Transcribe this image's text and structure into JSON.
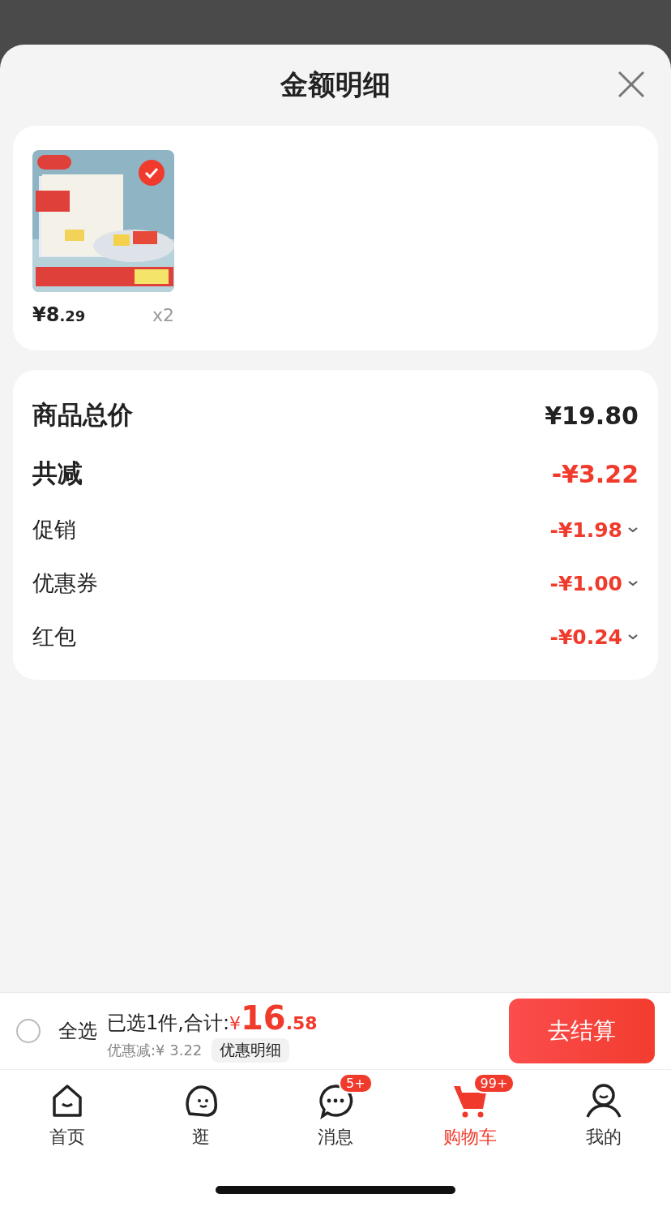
{
  "sheet": {
    "title": "金额明细"
  },
  "product": {
    "selected": true,
    "currency": "¥",
    "price_int": "8",
    "price_dec": ".29",
    "quantity": "x2"
  },
  "summary": [
    {
      "kind": "major",
      "label": "商品总价",
      "value": "¥19.80",
      "negative": false
    },
    {
      "kind": "major",
      "label": "共减",
      "value": "-¥3.22",
      "negative": true
    },
    {
      "kind": "minor",
      "label": "促销",
      "value": "-¥1.98",
      "negative": true,
      "expanded": false
    },
    {
      "kind": "minor",
      "label": "优惠券",
      "value": "-¥1.00",
      "negative": true,
      "expanded": false
    },
    {
      "kind": "minor",
      "label": "红包",
      "value": "-¥0.24",
      "negative": true,
      "expanded": false
    }
  ],
  "checkout": {
    "select_all": {
      "label": "全选",
      "checked": false
    },
    "summary_text": "已选1件,合计:",
    "currency": "¥",
    "total_int": "16",
    "total_dec": ".58",
    "discount_text": "优惠减:¥ 3.22",
    "detail_button": "优惠明细",
    "checkout_button": "去结算"
  },
  "tabs": [
    {
      "label": "首页",
      "kind": "home",
      "selected": false
    },
    {
      "label": "逛",
      "kind": "face",
      "selected": false
    },
    {
      "label": "消息",
      "kind": "chat",
      "badge": "5+",
      "selected": false
    },
    {
      "label": "购物车",
      "kind": "cart",
      "badge": "99+",
      "selected": true
    },
    {
      "label": "我的",
      "kind": "person",
      "selected": false
    }
  ]
}
